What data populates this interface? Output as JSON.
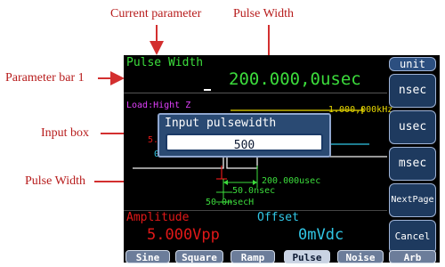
{
  "annotations": {
    "current_parameter": "Current parameter",
    "pulse_width_top": "Pulse Width",
    "parameter_bar": "Parameter bar 1",
    "input_box": "Input box",
    "pulse_width_side": "Pulse Width"
  },
  "param_bar": {
    "name": "Pulse Width",
    "value": "200.000,0usec"
  },
  "waveform": {
    "load": "Load:Hight Z",
    "freq_fragment": "1.000,000kHz",
    "amp_fragment": "5.",
    "offset_fragment": "0mVdc",
    "pw_label": "200.000usec",
    "rise_label": "50.0nsec",
    "fall_label": "50.0nsecH"
  },
  "dialog": {
    "title": "Input pulsewidth",
    "value": "500"
  },
  "bottom": {
    "amplitude_label": "Amplitude",
    "amplitude_value": "5.000Vpp",
    "offset_label": "Offset",
    "offset_value": "0mVdc"
  },
  "softkeys": {
    "header": "unit",
    "items": [
      "nsec",
      "usec",
      "msec",
      "NextPage",
      "Cancel"
    ]
  },
  "tabs": [
    "Sine",
    "Square",
    "Ramp",
    "Pulse",
    "Noise",
    "Arb"
  ],
  "active_tab": "Pulse",
  "colors": {
    "accent_green": "#3cdc3c",
    "amplitude_red": "#e01818",
    "offset_cyan": "#31c7e6",
    "wave_yellow": "#e8d800",
    "softkey_blue": "#1e3a5f",
    "annotation_red": "#b71c1c"
  }
}
